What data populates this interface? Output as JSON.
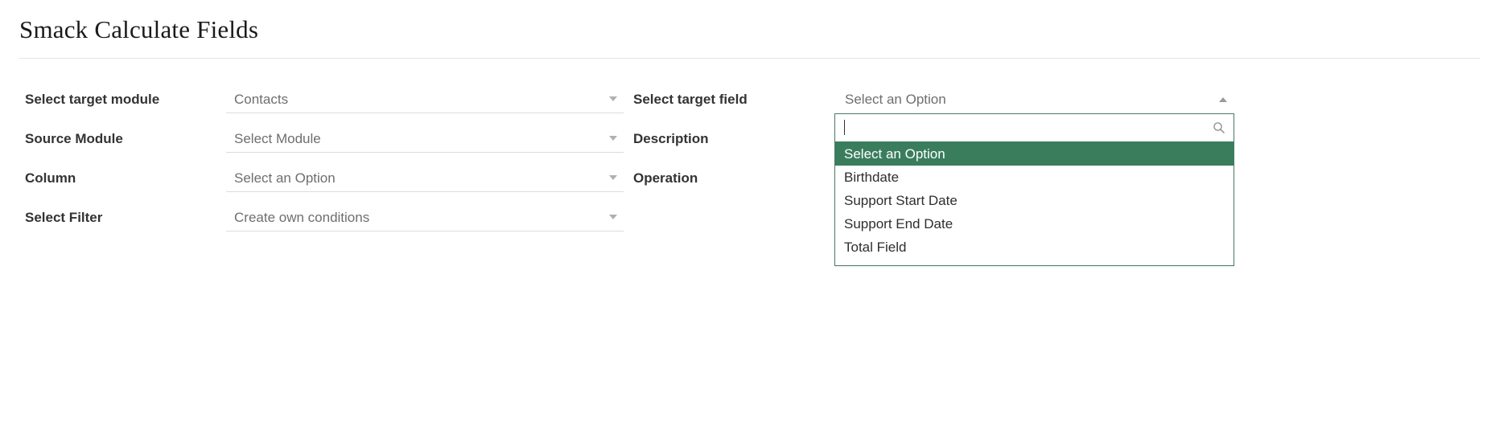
{
  "header": {
    "title": "Smack Calculate Fields"
  },
  "form": {
    "left_rows": [
      {
        "label": "Select target module",
        "value": "Contacts",
        "arrow_icon": "chevron-down-icon"
      },
      {
        "label": "Source Module",
        "value": "Select Module",
        "arrow_icon": "chevron-down-icon"
      },
      {
        "label": "Column",
        "value": "Select an Option",
        "arrow_icon": "chevron-down-icon"
      },
      {
        "label": "Select Filter",
        "value": "Create own conditions",
        "arrow_icon": "chevron-down-icon"
      }
    ],
    "right_rows": [
      {
        "label": "Select target field"
      },
      {
        "label": "Description"
      },
      {
        "label": "Operation"
      }
    ]
  },
  "target_field_dropdown": {
    "selected_value": "Select an Option",
    "arrow_icon": "chevron-up-icon",
    "search": {
      "value": "",
      "placeholder": "",
      "icon": "search-icon"
    },
    "options": [
      "Select an Option",
      "Birthdate",
      "Support Start Date",
      "Support End Date",
      "Total Field"
    ],
    "highlighted_index": 0
  },
  "colors": {
    "highlight_green": "#3a7d5d",
    "panel_border_green": "#4a7a63",
    "label_text": "#333333",
    "placeholder_text": "#6e6e6e",
    "underline": "#dcdcdc",
    "divider": "#e3e3e3"
  }
}
